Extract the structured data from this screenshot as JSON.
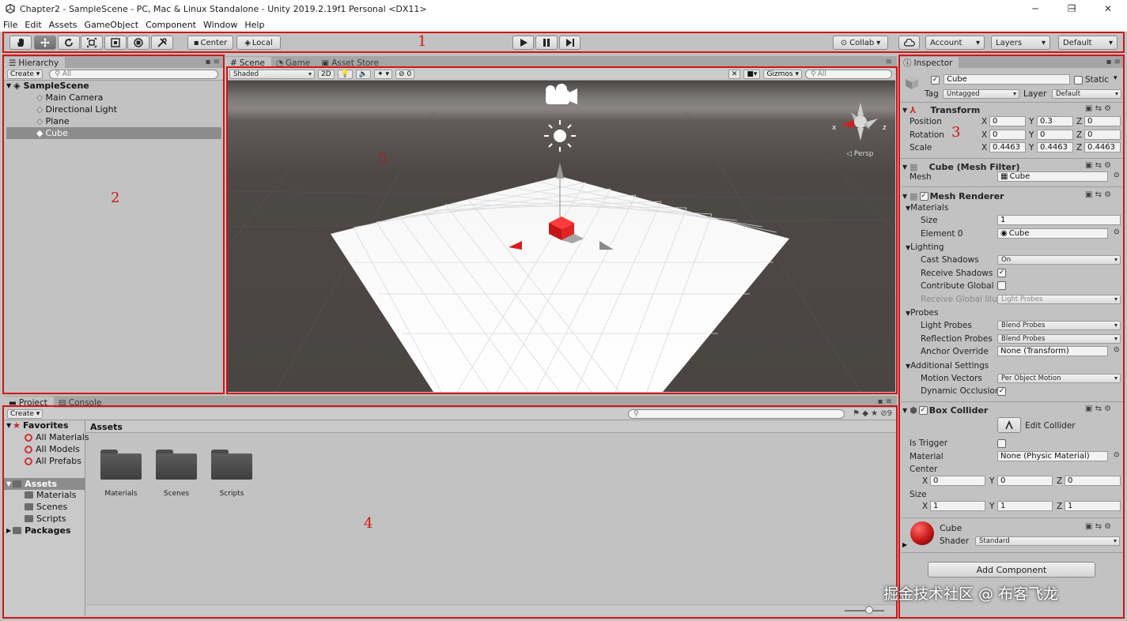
{
  "window": {
    "title": "Chapter2 - SampleScene - PC, Mac & Linux Standalone - Unity 2019.2.19f1 Personal <DX11>",
    "controls": [
      "─",
      "❐",
      "✕"
    ]
  },
  "menu": [
    "File",
    "Edit",
    "Assets",
    "GameObject",
    "Component",
    "Window",
    "Help"
  ],
  "toolbar": {
    "pivot": "Center",
    "space": "Local",
    "collab": "Collab",
    "account": "Account",
    "layers": "Layers",
    "layout": "Default"
  },
  "annotations": [
    "1",
    "2",
    "3",
    "4",
    "5"
  ],
  "hierarchy": {
    "tab": "Hierarchy",
    "create": "Create",
    "search_placeholder": "All",
    "scene": "SampleScene",
    "items": [
      "Main Camera",
      "Directional Light",
      "Plane",
      "Cube"
    ],
    "selected": "Cube"
  },
  "scene_view": {
    "tabs": [
      "Scene",
      "Game",
      "Asset Store"
    ],
    "shading": "Shaded",
    "mode_2d": "2D",
    "fx_count": "0",
    "gizmos": "Gizmos",
    "search_placeholder": "All",
    "persp": "Persp",
    "axis_x": "x",
    "axis_z": "z"
  },
  "inspector": {
    "tab": "Inspector",
    "object_name": "Cube",
    "static": "Static",
    "tag_label": "Tag",
    "tag": "Untagged",
    "layer_label": "Layer",
    "layer": "Default",
    "transform": {
      "title": "Transform",
      "position_label": "Position",
      "rotation_label": "Rotation",
      "scale_label": "Scale",
      "position": {
        "x": "0",
        "y": "0.3",
        "z": "0"
      },
      "rotation": {
        "x": "0",
        "y": "0",
        "z": "0"
      },
      "scale": {
        "x": "0.4463",
        "y": "0.4463",
        "z": "0.4463"
      },
      "axis_x": "X",
      "axis_y": "Y",
      "axis_z": "Z"
    },
    "mesh_filter": {
      "title": "Cube (Mesh Filter)",
      "mesh_label": "Mesh",
      "mesh": "Cube"
    },
    "mesh_renderer": {
      "title": "Mesh Renderer",
      "materials": "Materials",
      "size_label": "Size",
      "size": "1",
      "element0_label": "Element 0",
      "element0": "Cube",
      "lighting": "Lighting",
      "cast_shadows_label": "Cast Shadows",
      "cast_shadows": "On",
      "receive_shadows_label": "Receive Shadows",
      "contribute_gi_label": "Contribute Global I",
      "receive_gi_label": "Receive Global Illur",
      "receive_gi": "Light Probes",
      "probes": "Probes",
      "light_probes_label": "Light Probes",
      "light_probes": "Blend Probes",
      "reflection_probes_label": "Reflection Probes",
      "reflection_probes": "Blend Probes",
      "anchor_override_label": "Anchor Override",
      "anchor_override": "None (Transform)",
      "additional": "Additional Settings",
      "motion_vectors_label": "Motion Vectors",
      "motion_vectors": "Per Object Motion",
      "dynamic_occlusion_label": "Dynamic Occlusion"
    },
    "box_collider": {
      "title": "Box Collider",
      "edit_collider": "Edit Collider",
      "is_trigger_label": "Is Trigger",
      "material_label": "Material",
      "material": "None (Physic Material)",
      "center_label": "Center",
      "center": {
        "x": "0",
        "y": "0",
        "z": "0"
      },
      "size_label": "Size",
      "size": {
        "x": "1",
        "y": "1",
        "z": "1"
      }
    },
    "material": {
      "name": "Cube",
      "shader_label": "Shader",
      "shader": "Standard"
    },
    "add_component": "Add Component"
  },
  "project": {
    "tabs": [
      "Project",
      "Console"
    ],
    "create": "Create",
    "favorites": "Favorites",
    "favorite_items": [
      "All Materials",
      "All Models",
      "All Prefabs"
    ],
    "assets_root": "Assets",
    "asset_folders": [
      "Materials",
      "Scenes",
      "Scripts"
    ],
    "packages": "Packages",
    "breadcrumb": "Assets",
    "grid_items": [
      "Materials",
      "Scenes",
      "Scripts"
    ],
    "hidden_count": "9"
  },
  "watermark": "掘金技术社区 @ 布客飞龙",
  "colors": {
    "annotation_red": "#d21414",
    "cube_red": "#d41f1f",
    "selection": "#8c8c8c"
  }
}
